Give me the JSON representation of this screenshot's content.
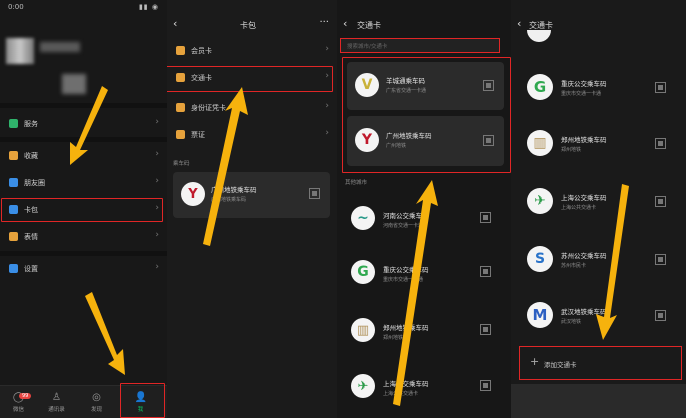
{
  "colors": {
    "accent_red": "#e02626",
    "arrow_orange": "#f6b20d",
    "wechat_green": "#07c160"
  },
  "panel1": {
    "status": {
      "time": "0:00",
      "icons": "▮▮ ◉"
    },
    "menu": [
      {
        "label": "服务",
        "icon": "service-icon",
        "color": "#2fb36b"
      },
      {
        "label": "收藏",
        "icon": "favorites-icon",
        "color": "#e6a23c"
      },
      {
        "label": "朋友圈",
        "icon": "moments-icon",
        "color": "#3a8ee6"
      },
      {
        "label": "卡包",
        "icon": "card-pack-icon",
        "color": "#3a8ee6"
      },
      {
        "label": "表情",
        "icon": "sticker-icon",
        "color": "#e6a23c"
      },
      {
        "label": "设置",
        "icon": "settings-icon",
        "color": "#3a8ee6"
      }
    ],
    "tabs": [
      {
        "label": "微信",
        "icon": "chat-icon",
        "badge": "99"
      },
      {
        "label": "通讯录",
        "icon": "contacts-icon"
      },
      {
        "label": "发现",
        "icon": "discover-icon"
      },
      {
        "label": "我",
        "icon": "me-icon"
      }
    ]
  },
  "panel2": {
    "title": "卡包",
    "menu": [
      {
        "label": "会员卡",
        "icon": "member-card-icon",
        "color": "#e6a23c"
      },
      {
        "label": "交通卡",
        "icon": "transit-card-icon",
        "color": "#e6a23c"
      },
      {
        "label": "身份证凭卡",
        "icon": "id-card-icon",
        "color": "#e6a23c"
      },
      {
        "label": "票证",
        "icon": "ticket-icon",
        "color": "#e6a23c"
      }
    ],
    "section": "乘车码",
    "card": {
      "name": "广州地铁乘车码",
      "sub": "广州地铁乘车码"
    }
  },
  "panel3": {
    "title": "交通卡",
    "search_placeholder": "搜索城市/交通卡",
    "cards": [
      {
        "name": "羊城通乘车码",
        "sub": "广东省交通一卡通",
        "logo_text": "V",
        "logo_color": "#c9b23a"
      },
      {
        "name": "广州地铁乘车码",
        "sub": "广州地铁",
        "logo_text": "Y",
        "logo_color": "#c0192c"
      }
    ],
    "section": "其他城市",
    "list": [
      {
        "name": "河南公交乘车码",
        "sub": "河南省交通一卡通",
        "logo_text": "~",
        "logo_color": "#2a9a8a"
      },
      {
        "name": "重庆公交乘车码",
        "sub": "重庆市交通一卡通",
        "logo_text": "G",
        "logo_color": "#2fa84f"
      },
      {
        "name": "郑州地铁乘车码",
        "sub": "郑州地铁",
        "logo_text": "▥",
        "logo_color": "#b0925a"
      },
      {
        "name": "上海公交乘车码",
        "sub": "上海公共交通卡",
        "logo_text": "✈",
        "logo_color": "#2c9b4a"
      }
    ]
  },
  "panel4": {
    "title": "交通卡",
    "list": [
      {
        "name": "重庆公交乘车码",
        "sub": "重庆市交通一卡通",
        "logo_text": "G",
        "logo_color": "#2fa84f"
      },
      {
        "name": "郑州地铁乘车码",
        "sub": "郑州地铁",
        "logo_text": "▥",
        "logo_color": "#b0925a"
      },
      {
        "name": "上海公交乘车码",
        "sub": "上海公共交通卡",
        "logo_text": "✈",
        "logo_color": "#2c9b4a"
      },
      {
        "name": "苏州公交乘车码",
        "sub": "苏州市民卡",
        "logo_text": "S",
        "logo_color": "#2a73c9"
      },
      {
        "name": "武汉地铁乘车码",
        "sub": "武汉地铁",
        "logo_text": "M",
        "logo_color": "#2c5fc2"
      }
    ],
    "add_label": "添加交通卡"
  }
}
